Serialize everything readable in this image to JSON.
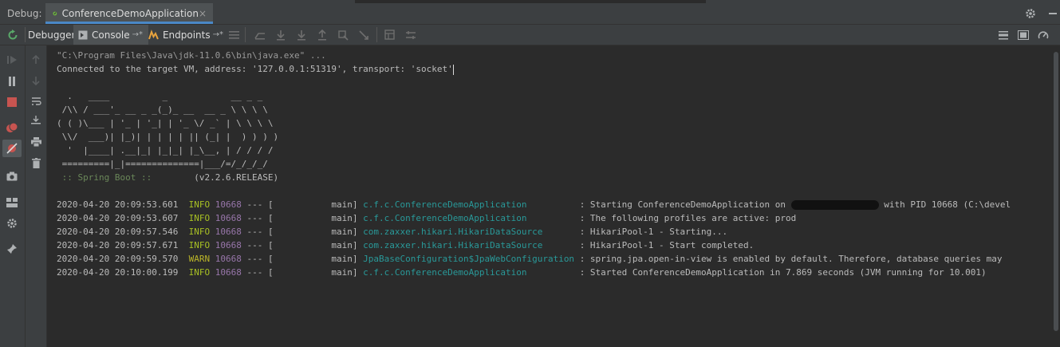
{
  "title_bar": {
    "label": "Debug:",
    "tab": {
      "label": "ConferenceDemoApplication",
      "close": "×"
    }
  },
  "toolbar": {
    "tabs": [
      {
        "label": "Debugger"
      },
      {
        "label": "Console",
        "pin": "→*"
      },
      {
        "label": "Endpoints",
        "pin": "→*"
      }
    ]
  },
  "console": {
    "lines": [
      {
        "text": "\"C:\\Program Files\\Java\\jdk-11.0.6\\bin\\java.exe\" ..."
      },
      {
        "text": "Connected to the target VM, address: '127.0.0.1:51319', transport: 'socket'"
      }
    ],
    "banner": [
      "  .   ____          _            __ _ _",
      " /\\\\ / ___'_ __ _ _(_)_ __  __ _ \\ \\ \\ \\",
      "( ( )\\___ | '_ | '_| | '_ \\/ _` | \\ \\ \\ \\",
      " \\\\/  ___)| |_)| | | | | || (_| |  ) ) ) )",
      "  '  |____| .__|_| |_|_| |_\\__, | / / / /",
      " =========|_|==============|___/=/_/_/_/"
    ],
    "spring_boot_label": " :: Spring Boot :: ",
    "spring_boot_version": "       (v2.2.6.RELEASE)",
    "logs": [
      {
        "ts": "2020-04-20 20:09:53.601",
        "level": "INFO",
        "pid": "10668",
        "sep": " --- [           main] ",
        "logger": "c.f.c.ConferenceDemoApplication          ",
        "msg": ": Starting ConferenceDemoApplication on ",
        "redacted": true,
        "msg2": " with PID 10668 (C:\\devel"
      },
      {
        "ts": "2020-04-20 20:09:53.607",
        "level": "INFO",
        "pid": "10668",
        "sep": " --- [           main] ",
        "logger": "c.f.c.ConferenceDemoApplication          ",
        "msg": ": The following profiles are active: prod"
      },
      {
        "ts": "2020-04-20 20:09:57.546",
        "level": "INFO",
        "pid": "10668",
        "sep": " --- [           main] ",
        "logger": "com.zaxxer.hikari.HikariDataSource       ",
        "msg": ": HikariPool-1 - Starting..."
      },
      {
        "ts": "2020-04-20 20:09:57.671",
        "level": "INFO",
        "pid": "10668",
        "sep": " --- [           main] ",
        "logger": "com.zaxxer.hikari.HikariDataSource       ",
        "msg": ": HikariPool-1 - Start completed."
      },
      {
        "ts": "2020-04-20 20:09:59.570",
        "level": "WARN",
        "pid": "10668",
        "sep": " --- [           main] ",
        "logger": "JpaBaseConfiguration$JpaWebConfiguration ",
        "msg": ": spring.jpa.open-in-view is enabled by default. Therefore, database queries may"
      },
      {
        "ts": "2020-04-20 20:10:00.199",
        "level": "INFO",
        "pid": "10668",
        "sep": " --- [           main] ",
        "logger": "c.f.c.ConferenceDemoApplication          ",
        "msg": ": Started ConferenceDemoApplication in 7.869 seconds (JVM running for 10.001)"
      }
    ]
  },
  "colors": {
    "accent": "#4a88c7",
    "info_level": "#a8c023",
    "warn_level": "#bbb529",
    "pid": "#9876aa",
    "logger": "#299999",
    "spring_boot": "#6a8759"
  },
  "icons": {
    "left_toolbar": [
      "rerun-icon",
      "resume-icon",
      "pause-icon",
      "stop-icon",
      "view-breakpoints-icon",
      "mute-breakpoints-icon",
      "camera-icon",
      "layout-icon",
      "settings-icon",
      "pin-icon"
    ],
    "console_gutter": [
      "up-stack-icon",
      "down-stack-icon",
      "soft-wrap-icon",
      "scroll-to-end-icon",
      "print-icon",
      "trash-icon"
    ],
    "step_toolbar": [
      "menu-icon",
      "show-execution-point-icon",
      "step-over-icon",
      "step-into-icon",
      "force-step-into-icon",
      "step-out-icon",
      "drop-frame-icon",
      "run-to-cursor-icon",
      "evaluate-expression-icon",
      "trace-icon"
    ]
  }
}
